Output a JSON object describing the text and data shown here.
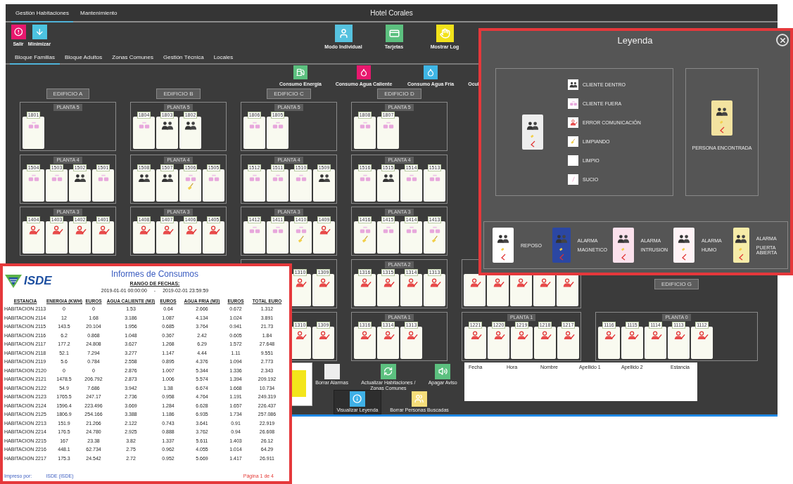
{
  "window": {
    "tabs": [
      {
        "label": "Gestión Habitaciones",
        "selected": true
      },
      {
        "label": "Mantenimiento",
        "selected": false
      }
    ],
    "title": "Hotel Corales"
  },
  "toolbar_left": [
    {
      "label": "Salir",
      "color": "#e8186e"
    },
    {
      "label": "Minimizar",
      "color": "#4cc3e0"
    }
  ],
  "toolbar_right": [
    {
      "label": "Modo Individual",
      "color": "#56c2df"
    },
    {
      "label": "Tarjetas",
      "color": "#5cc07f"
    },
    {
      "label": "Mostrar Log",
      "color": "#f2e21a"
    }
  ],
  "subtabs": [
    {
      "label": "Bloque Familias",
      "selected": true
    },
    {
      "label": "Bloque Adultos",
      "selected": false
    },
    {
      "label": "Zonas Comunes",
      "selected": false
    },
    {
      "label": "Gestión Técnica",
      "selected": false
    },
    {
      "label": "Locales",
      "selected": false
    }
  ],
  "consumption": [
    {
      "label": "Consumo Energía",
      "color": "#5cc07f"
    },
    {
      "label": "Consumo Agua Caliente",
      "color": "#e8186e"
    },
    {
      "label": "Consumo Agua Fría",
      "color": "#3fb6e6"
    },
    {
      "label": "Ocul"
    }
  ],
  "buildings": [
    {
      "slots": [
        {
          "kind": "header",
          "label": "EDIFICIO A"
        },
        {
          "kind": "floor",
          "label": "PLANTA 5",
          "rooms": [
            {
              "number": "1801",
              "kind": "out",
              "cleaning": false
            }
          ]
        },
        {
          "kind": "floor",
          "label": "PLANTA 4",
          "rooms": [
            {
              "number": "1504",
              "kind": "out",
              "cleaning": false
            },
            {
              "number": "1503",
              "kind": "out",
              "cleaning": false
            },
            {
              "number": "1502",
              "kind": "in",
              "cleaning": false
            },
            {
              "number": "1501",
              "kind": "out",
              "cleaning": false
            }
          ]
        },
        {
          "kind": "floor",
          "label": "PLANTA 3",
          "rooms": [
            {
              "number": "1404",
              "kind": "error",
              "cleaning": false
            },
            {
              "number": "1403",
              "kind": "error",
              "cleaning": false
            },
            {
              "number": "1402",
              "kind": "error",
              "cleaning": false
            },
            {
              "number": "1401",
              "kind": "error",
              "cleaning": false
            }
          ]
        }
      ]
    },
    {
      "slots": [
        {
          "kind": "header",
          "label": "EDIFICIO B"
        },
        {
          "kind": "floor",
          "label": "PLANTA 5",
          "rooms": [
            {
              "number": "1804",
              "kind": "out",
              "cleaning": false
            },
            {
              "number": "1803",
              "kind": "in",
              "cleaning": false
            },
            {
              "number": "1802",
              "kind": "in",
              "cleaning": false
            }
          ]
        },
        {
          "kind": "floor",
          "label": "PLANTA 4",
          "rooms": [
            {
              "number": "1508",
              "kind": "in",
              "cleaning": false
            },
            {
              "number": "1507",
              "kind": "in",
              "cleaning": false
            },
            {
              "number": "1506",
              "kind": "out",
              "cleaning": true
            },
            {
              "number": "1505",
              "kind": "out",
              "cleaning": false
            }
          ]
        },
        {
          "kind": "floor",
          "label": "PLANTA 3",
          "rooms": [
            {
              "number": "1408",
              "kind": "error",
              "cleaning": false
            },
            {
              "number": "1407",
              "kind": "error",
              "cleaning": false
            },
            {
              "number": "1406",
              "kind": "error",
              "cleaning": false
            },
            {
              "number": "1405",
              "kind": "error",
              "cleaning": false
            }
          ]
        }
      ]
    },
    {
      "slots": [
        {
          "kind": "header",
          "label": "EDIFICIO C"
        },
        {
          "kind": "floor",
          "label": "PLANTA 5",
          "rooms": [
            {
              "number": "1806",
              "kind": "out",
              "cleaning": false
            },
            {
              "number": "1805",
              "kind": "out",
              "cleaning": false
            }
          ]
        },
        {
          "kind": "floor",
          "label": "PLANTA 4",
          "rooms": [
            {
              "number": "1512",
              "kind": "out",
              "cleaning": false
            },
            {
              "number": "1511",
              "kind": "out",
              "cleaning": false
            },
            {
              "number": "1510",
              "kind": "out",
              "cleaning": false
            },
            {
              "number": "1509",
              "kind": "in",
              "cleaning": false
            }
          ]
        },
        {
          "kind": "floor",
          "label": "PLANTA 3",
          "rooms": [
            {
              "number": "1412",
              "kind": "out",
              "cleaning": false
            },
            {
              "number": "1411",
              "kind": "out",
              "cleaning": false
            },
            {
              "number": "1410",
              "kind": "out",
              "cleaning": true
            },
            {
              "number": "1409",
              "kind": "error",
              "cleaning": false
            }
          ]
        },
        {
          "kind": "floor",
          "rooms": [
            {
              "number": "1310",
              "kind": "error",
              "cleaning": false
            },
            {
              "number": "1309",
              "kind": "error",
              "cleaning": false
            }
          ]
        },
        {
          "kind": "floor",
          "rooms": [
            {
              "number": "1310",
              "kind": "error",
              "cleaning": false
            },
            {
              "number": "1309",
              "kind": "error",
              "cleaning": false
            }
          ]
        }
      ]
    },
    {
      "slots": [
        {
          "kind": "header",
          "label": "EDIFICIO D"
        },
        {
          "kind": "floor",
          "label": "PLANTA 5",
          "rooms": [
            {
              "number": "1808",
              "kind": "out",
              "cleaning": false
            },
            {
              "number": "1807",
              "kind": "out",
              "cleaning": false
            }
          ]
        },
        {
          "kind": "floor",
          "label": "PLANTA 4",
          "rooms": [
            {
              "number": "1516",
              "kind": "out",
              "cleaning": false
            },
            {
              "number": "1515",
              "kind": "in",
              "cleaning": false
            },
            {
              "number": "1514",
              "kind": "out",
              "cleaning": false
            },
            {
              "number": "1513",
              "kind": "out",
              "cleaning": false
            }
          ]
        },
        {
          "kind": "floor",
          "label": "PLANTA 3",
          "rooms": [
            {
              "number": "1416",
              "kind": "out",
              "cleaning": true
            },
            {
              "number": "1415",
              "kind": "out",
              "cleaning": false
            },
            {
              "number": "1414",
              "kind": "out",
              "cleaning": false
            },
            {
              "number": "1413",
              "kind": "out",
              "cleaning": true
            }
          ]
        },
        {
          "kind": "floor",
          "label": "PLANTA 2",
          "rooms": [
            {
              "number": "1316",
              "kind": "error",
              "cleaning": false
            },
            {
              "number": "1315",
              "kind": "error",
              "cleaning": false
            },
            {
              "number": "1314",
              "kind": "error",
              "cleaning": false
            },
            {
              "number": "1313",
              "kind": "error",
              "cleaning": false
            }
          ]
        },
        {
          "kind": "floor",
          "label": "PLANTA 1",
          "rooms": [
            {
              "number": "1316",
              "kind": "error",
              "cleaning": false
            },
            {
              "number": "1314",
              "kind": "error",
              "cleaning": false
            },
            {
              "number": "1313",
              "kind": "error",
              "cleaning": false
            }
          ]
        }
      ]
    },
    {
      "slots": [
        {
          "kind": "floor",
          "rooms": [
            {
              "kind": "error",
              "cleaning": false
            },
            {
              "kind": "error",
              "cleaning": false
            },
            {
              "kind": "error",
              "cleaning": false
            },
            {
              "kind": "error",
              "cleaning": false
            },
            {
              "kind": "error",
              "cleaning": false
            }
          ]
        },
        {
          "kind": "floor",
          "label": "PLANTA 1",
          "rooms": [
            {
              "number": "1221",
              "kind": "error",
              "cleaning": false
            },
            {
              "number": "1220",
              "kind": "error",
              "cleaning": false
            },
            {
              "number": "1219",
              "kind": "error",
              "cleaning": false
            },
            {
              "number": "1218",
              "kind": "error",
              "cleaning": false
            },
            {
              "number": "1217",
              "kind": "error",
              "cleaning": false
            }
          ]
        }
      ]
    },
    {
      "slots": [
        {
          "kind": "header",
          "label": "EDIFICIO G"
        },
        {
          "kind": "floor",
          "label": "PLANTA 0",
          "rooms": [
            {
              "number": "1116",
              "kind": "error",
              "cleaning": false
            },
            {
              "number": "1115",
              "kind": "error",
              "cleaning": false
            },
            {
              "number": "1114",
              "kind": "error",
              "cleaning": false
            },
            {
              "number": "1113",
              "kind": "error",
              "cleaning": false
            },
            {
              "number": "1112",
              "kind": "error",
              "cleaning": false
            }
          ]
        }
      ]
    }
  ],
  "actions_top": [
    {
      "label": "Borrar Alarmas",
      "color": "#eeeeee",
      "selected": false
    },
    {
      "label": "Actualizar Habitaciones / Zonas Comunes",
      "color": "#5cc07f",
      "selected": false
    },
    {
      "label": "Apagar Aviso",
      "color": "#5cc07f",
      "selected": false
    }
  ],
  "actions_bottom": [
    {
      "label": "Visualizar Leyenda",
      "color": "#3fb0e6",
      "selected": true
    },
    {
      "label": "Borrar Personas Buscadas",
      "color": "#f5dd7a",
      "selected": false
    }
  ],
  "events": {
    "columns": [
      "Fecha",
      "Hora",
      "Nombre",
      "Apellido 1",
      "Apellido 2",
      "Estancia"
    ]
  },
  "legend": {
    "title": "Leyenda",
    "states": [
      {
        "label": "CLIENTE DENTRO",
        "kind": "in"
      },
      {
        "label": "CLIENTE FUERA",
        "kind": "out"
      },
      {
        "label": "ERROR COMUNICACIÓN",
        "kind": "error"
      },
      {
        "label": "LIMPIANDO",
        "kind": "cleaning"
      },
      {
        "label": "LIMPIO",
        "kind": "clean"
      },
      {
        "label": "SUCIO",
        "kind": "dirty"
      }
    ],
    "found": {
      "label": "PERSONA ENCONTRADA",
      "color": "#f3e3a0"
    },
    "alarms": [
      {
        "lines": [
          "REPOSO"
        ],
        "color": "#ffffff"
      },
      {
        "lines": [
          "ALARMA",
          "MAGNETICO"
        ],
        "color": "#2b47a3"
      },
      {
        "lines": [
          "ALARMA",
          "INTRUSION"
        ],
        "color": "#fbe1ec"
      },
      {
        "lines": [
          "ALARMA",
          "HUMO"
        ],
        "color": "#fff3f6"
      },
      {
        "lines": [
          "ALARMA",
          "PUERTA ABIERTA"
        ],
        "color": "#f6eca8"
      }
    ]
  },
  "report": {
    "logo": "ISDE",
    "title": "Informes de Consumos",
    "range_label": "RANGO DE FECHAS:",
    "date_from": "2019-01-01 00:00:00",
    "separator": "-",
    "date_to": "2019-02-01 23:59:59",
    "columns": [
      "ESTANCIA",
      "ENERGIA (KWH)",
      "EUROS",
      "AGUA CALIENTE (M3)",
      "EUROS",
      "AGUA FRIA (M3)",
      "EUROS",
      "TOTAL EURO"
    ],
    "rows": [
      [
        "HABITACION 2113",
        "0",
        "0",
        "1.53",
        "0.64",
        "2.666",
        "0.672",
        "1.312"
      ],
      [
        "HABITACION 2114",
        "12",
        "1.68",
        "3.186",
        "1.087",
        "4.134",
        "1.024",
        "3.891"
      ],
      [
        "HABITACION 2115",
        "143.5",
        "20.104",
        "1.956",
        "0.685",
        "3.764",
        "0.941",
        "21.73"
      ],
      [
        "HABITACION 2116",
        "6.2",
        "0.868",
        "1.048",
        "0.367",
        "2.42",
        "0.605",
        "1.84"
      ],
      [
        "HABITACION 2117",
        "177.2",
        "24.808",
        "3.627",
        "1.268",
        "6.29",
        "1.572",
        "27.648"
      ],
      [
        "HABITACION 2118",
        "52.1",
        "7.294",
        "3.277",
        "1.147",
        "4.44",
        "1.11",
        "9.551"
      ],
      [
        "HABITACION 2119",
        "5.6",
        "0.784",
        "2.558",
        "0.895",
        "4.376",
        "1.094",
        "2.773"
      ],
      [
        "HABITACION 2120",
        "0",
        "0",
        "2.876",
        "1.007",
        "5.344",
        "1.336",
        "2.343"
      ],
      [
        "HABITACION 2121",
        "1478.5",
        "206.792",
        "2.873",
        "1.006",
        "5.574",
        "1.394",
        "209.192"
      ],
      [
        "HABITACION 2122",
        "54.9",
        "7.686",
        "3.942",
        "1.38",
        "6.674",
        "1.668",
        "10.734"
      ],
      [
        "HABITACION 2123",
        "1765.5",
        "247.17",
        "2.736",
        "0.958",
        "4.764",
        "1.191",
        "249.319"
      ],
      [
        "HABITACION 2124",
        "1596.4",
        "223.496",
        "3.669",
        "1.284",
        "6.628",
        "1.657",
        "226.437"
      ],
      [
        "HABITACION 2125",
        "1806.9",
        "254.166",
        "3.388",
        "1.186",
        "6.935",
        "1.734",
        "257.086"
      ],
      [
        "HABITACION 2213",
        "151.9",
        "21.266",
        "2.122",
        "0.743",
        "3.641",
        "0.91",
        "22.919"
      ],
      [
        "HABITACION 2214",
        "176.5",
        "24.780",
        "2.925",
        "0.888",
        "3.762",
        "0.94",
        "26.608"
      ],
      [
        "HABITACION 2215",
        "167",
        "23.38",
        "3.82",
        "1.337",
        "5.611",
        "1.403",
        "26.12"
      ],
      [
        "HABITACION 2216",
        "448.1",
        "62.734",
        "2.75",
        "0.962",
        "4.055",
        "1.014",
        "64.29"
      ],
      [
        "HABITACION 2217",
        "175.3",
        "24.542",
        "2.72",
        "0.952",
        "5.669",
        "1.417",
        "26.911"
      ]
    ],
    "footer_left": "Impreso por:",
    "footer_user": "ISDE (ISDE)",
    "page": "Página 1 de 4"
  }
}
